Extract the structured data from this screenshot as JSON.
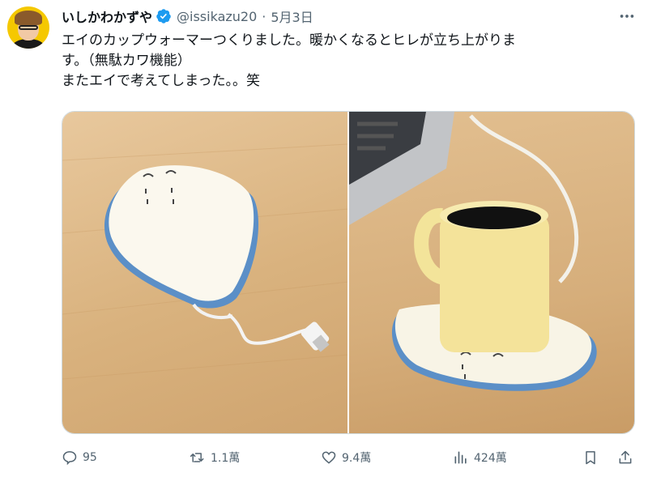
{
  "user": {
    "display_name": "いしかわかずや",
    "handle": "@issikazu20",
    "separator": "·",
    "date": "5月3日"
  },
  "tweet": {
    "text": "エイのカップウォーマーつくりました。暖かくなるとヒレが立ち上がりま\nす。（無駄カワ機能）\nまたエイで考えてしまった。。笑"
  },
  "actions": {
    "reply_count": "95",
    "retweet_count": "1.1萬",
    "like_count": "9.4萬",
    "view_count": "424萬"
  },
  "colors": {
    "verified": "#1d9bf0",
    "secondary_text": "#536471",
    "border": "#cfd9de"
  },
  "icons": [
    "verified-badge-icon",
    "more-icon",
    "reply-icon",
    "retweet-icon",
    "like-icon",
    "views-icon",
    "bookmark-icon",
    "share-icon"
  ]
}
